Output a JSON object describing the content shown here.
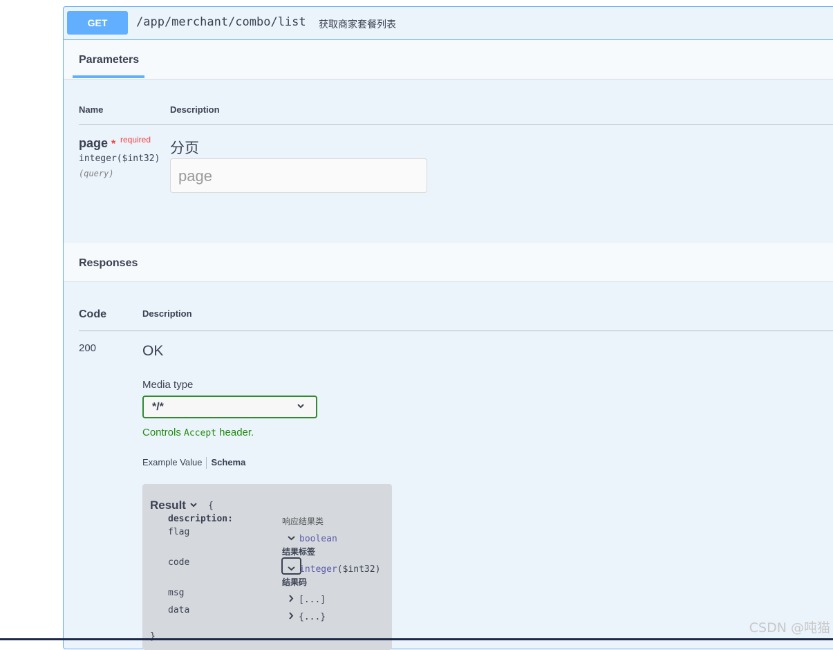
{
  "operation": {
    "method": "GET",
    "path": "/app/merchant/combo/list",
    "summary": "获取商家套餐列表"
  },
  "parameters": {
    "tab_label": "Parameters",
    "col_name": "Name",
    "col_description": "Description",
    "items": [
      {
        "name": "page",
        "required_star": "*",
        "required_label": "required",
        "type": "integer($int32)",
        "in": "(query)",
        "description": "分页",
        "placeholder": "page"
      }
    ]
  },
  "responses": {
    "title": "Responses",
    "col_code": "Code",
    "col_description": "Description",
    "items": [
      {
        "code": "200",
        "description": "OK",
        "media_type_label": "Media type",
        "media_type_value": "*/*",
        "controls_prefix": "Controls",
        "controls_mono": "Accept",
        "controls_suffix": "header.",
        "example_tab": "Example Value",
        "schema_tab": "Schema",
        "schema": {
          "model_name": "Result",
          "open_brace": "{",
          "close_brace": "}",
          "description_key": "description:",
          "description_value": "响应结果类",
          "properties": [
            {
              "name": "flag",
              "type": "boolean",
              "label": "结果标签",
              "expanded": true
            },
            {
              "name": "code",
              "type": "integer",
              "format": "($int32)",
              "label": "结果码",
              "expanded": true
            },
            {
              "name": "msg",
              "type": "[...]",
              "expanded": false
            },
            {
              "name": "data",
              "type": "{...}",
              "expanded": false
            }
          ]
        }
      }
    ]
  },
  "watermark": "CSDN @吨猫",
  "colors": {
    "get_accent": "#61affe",
    "required": "#f93e3e",
    "valid_green": "#248c12"
  }
}
